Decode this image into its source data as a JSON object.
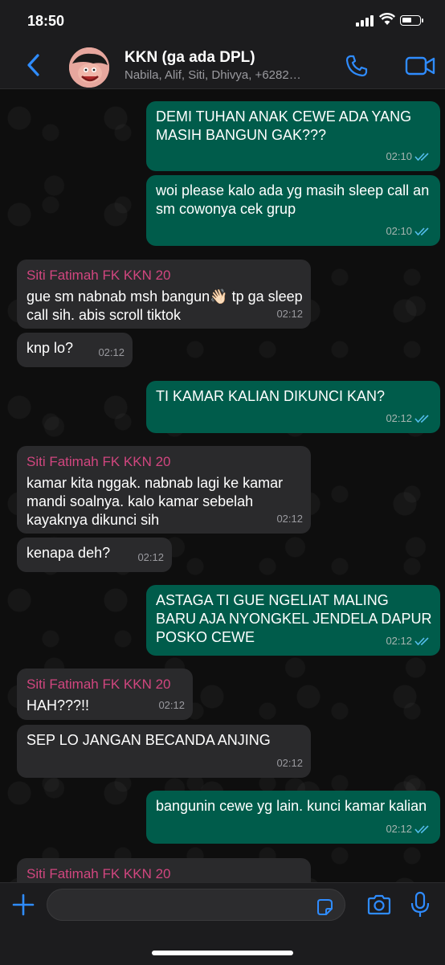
{
  "status_bar": {
    "time": "18:50"
  },
  "header": {
    "title": "KKN (ga ada DPL)",
    "subtitle": "Nabila, Alif, Siti, Dhivya, +6282…"
  },
  "messages": [
    {
      "id": 1,
      "dir": "out",
      "text": "DEMI TUHAN ANAK CEWE ADA YANG MASIH BANGUN GAK???",
      "time": "02:10"
    },
    {
      "id": 2,
      "dir": "out",
      "text": "woi please kalo ada yg masih sleep call an sm cowonya cek grup",
      "time": "02:10"
    },
    {
      "id": 3,
      "dir": "in",
      "sender": "Siti Fatimah FK KKN 20",
      "text": "gue sm nabnab msh bangun👋🏻 tp ga sleep call sih. abis scroll tiktok",
      "time": "02:12"
    },
    {
      "id": 4,
      "dir": "in",
      "text": "knp lo?",
      "time": "02:12"
    },
    {
      "id": 5,
      "dir": "out",
      "text": "TI KAMAR KALIAN DIKUNCI KAN?",
      "time": "02:12"
    },
    {
      "id": 6,
      "dir": "in",
      "sender": "Siti Fatimah FK KKN 20",
      "text": "kamar kita nggak. nabnab lagi ke kamar mandi soalnya. kalo kamar sebelah kayaknya dikunci sih",
      "time": "02:12"
    },
    {
      "id": 7,
      "dir": "in",
      "text": "kenapa deh?",
      "time": "02:12"
    },
    {
      "id": 8,
      "dir": "out",
      "text": "ASTAGA TI GUE NGELIAT MALING BARU AJA NYONGKEL JENDELA DAPUR POSKO CEWE",
      "time": "02:12"
    },
    {
      "id": 9,
      "dir": "in",
      "sender": "Siti Fatimah FK KKN 20",
      "text": "HAH???!!",
      "time": "02:12"
    },
    {
      "id": 10,
      "dir": "in",
      "text": "SEP LO JANGAN BECANDA ANJING",
      "time": "02:12"
    },
    {
      "id": 11,
      "dir": "out",
      "text": "bangunin cewe yg lain. kunci kamar kalian",
      "time": "02:12"
    },
    {
      "id": 12,
      "dir": "in",
      "sender": "Siti Fatimah FK KKN 20",
      "text": "",
      "time": ""
    }
  ],
  "colors": {
    "outgoing": "#005c4b",
    "incoming": "#2a2a2c",
    "accent": "#2f8cff",
    "sender": "#d1467f",
    "ticks": "#53bdeb"
  },
  "icons": {
    "back": "chevron-left-icon",
    "call": "phone-icon",
    "video": "video-camera-icon",
    "attach": "plus-icon",
    "sticker": "sticker-icon",
    "camera": "camera-icon",
    "mic": "microphone-icon"
  }
}
